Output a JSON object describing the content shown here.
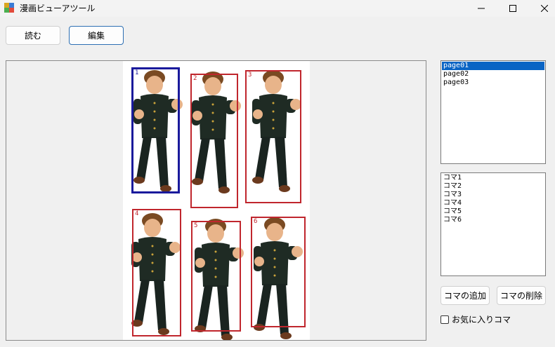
{
  "window": {
    "title": "漫画ビューアツール",
    "controls": {
      "minimize_icon": "minimize-icon",
      "maximize_icon": "maximize-icon",
      "close_icon": "close-icon"
    }
  },
  "toolbar": {
    "read_label": "読む",
    "edit_label": "編集"
  },
  "viewer": {
    "frames": [
      {
        "label": "1",
        "selected": true
      },
      {
        "label": "2",
        "selected": false
      },
      {
        "label": "3",
        "selected": false
      },
      {
        "label": "4",
        "selected": false
      },
      {
        "label": "5",
        "selected": false
      },
      {
        "label": "6",
        "selected": false
      }
    ],
    "colors": {
      "frame": "#c0262d",
      "selected_frame": "#1a1a9c"
    }
  },
  "page_list": {
    "items": [
      "page01",
      "page02",
      "page03"
    ],
    "selected_index": 0
  },
  "frame_list": {
    "items": [
      "コマ1",
      "コマ2",
      "コマ3",
      "コマ4",
      "コマ5",
      "コマ6"
    ]
  },
  "actions": {
    "add_frame_label": "コマの追加",
    "delete_frame_label": "コマの削除"
  },
  "favorite": {
    "label": "お気に入りコマ",
    "checked": false
  }
}
